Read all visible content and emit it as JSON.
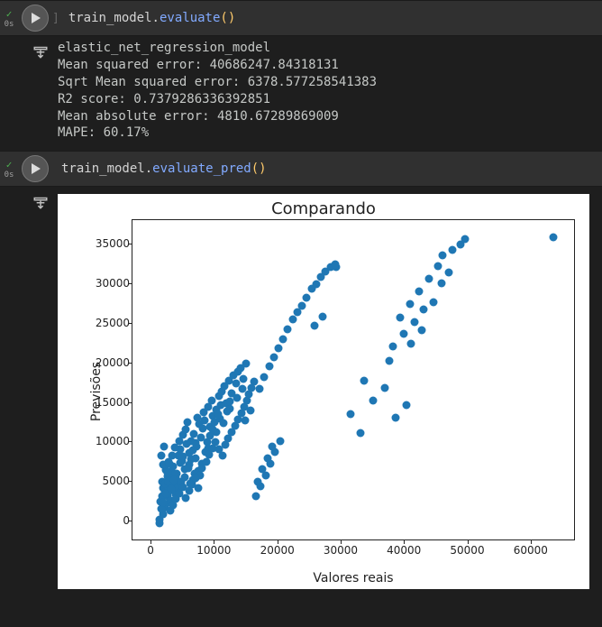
{
  "cell1": {
    "status_time": "0s",
    "code_obj": "train_model",
    "code_dot": ".",
    "code_func": "evaluate",
    "code_open": "(",
    "code_close": ")",
    "output_lines": [
      "elastic_net_regression_model",
      "Mean squared error: 40686247.84318131",
      "Sqrt Mean squared error: 6378.577258541383",
      "R2 score: 0.7379286336392851",
      "Mean absolute error: 4810.67289869009",
      "MAPE: 60.17%"
    ]
  },
  "cell2": {
    "status_time": "0s",
    "code_obj": "train_model",
    "code_dot": ".",
    "code_func": "evaluate_pred",
    "code_open": "(",
    "code_close": ")"
  },
  "chart_data": {
    "type": "scatter",
    "title": "Comparando",
    "xlabel": "Valores reais",
    "ylabel": "Previsões",
    "xlim": [
      -3000,
      67000
    ],
    "ylim": [
      -2500,
      38000
    ],
    "xticks": [
      0,
      10000,
      20000,
      30000,
      40000,
      50000,
      60000
    ],
    "yticks": [
      0,
      5000,
      10000,
      15000,
      20000,
      25000,
      30000,
      35000
    ],
    "series": [
      {
        "name": "pred_vs_real",
        "points": [
          [
            1200,
            -200
          ],
          [
            1300,
            250
          ],
          [
            1800,
            900
          ],
          [
            2000,
            1800
          ],
          [
            1400,
            2600
          ],
          [
            2200,
            2200
          ],
          [
            2500,
            3200
          ],
          [
            1900,
            4200
          ],
          [
            2800,
            3900
          ],
          [
            1700,
            5100
          ],
          [
            3200,
            4800
          ],
          [
            3000,
            2700
          ],
          [
            2600,
            5700
          ],
          [
            3600,
            5200
          ],
          [
            3100,
            6300
          ],
          [
            4000,
            6100
          ],
          [
            3400,
            7000
          ],
          [
            4500,
            7400
          ],
          [
            3800,
            5600
          ],
          [
            4200,
            8300
          ],
          [
            4800,
            7700
          ],
          [
            5200,
            6600
          ],
          [
            4600,
            9100
          ],
          [
            5000,
            8200
          ],
          [
            5500,
            9800
          ],
          [
            5900,
            8700
          ],
          [
            6300,
            10200
          ],
          [
            6000,
            7200
          ],
          [
            6700,
            11100
          ],
          [
            7100,
            9500
          ],
          [
            7500,
            12300
          ],
          [
            7800,
            10600
          ],
          [
            6900,
            8000
          ],
          [
            7300,
            13100
          ],
          [
            8100,
            11800
          ],
          [
            8400,
            12800
          ],
          [
            8800,
            10000
          ],
          [
            8200,
            13800
          ],
          [
            9000,
            14500
          ],
          [
            9300,
            12000
          ],
          [
            9700,
            13300
          ],
          [
            9500,
            15300
          ],
          [
            10200,
            14100
          ],
          [
            10600,
            15800
          ],
          [
            10300,
            11300
          ],
          [
            11100,
            16400
          ],
          [
            10800,
            13000
          ],
          [
            11500,
            17100
          ],
          [
            11800,
            15000
          ],
          [
            12200,
            17800
          ],
          [
            12600,
            16200
          ],
          [
            12900,
            18500
          ],
          [
            12400,
            14300
          ],
          [
            13300,
            17400
          ],
          [
            13700,
            18900
          ],
          [
            13500,
            15600
          ],
          [
            14100,
            19400
          ],
          [
            14500,
            18000
          ],
          [
            14300,
            16800
          ],
          [
            14900,
            19900
          ],
          [
            3900,
            3400
          ],
          [
            4300,
            4500
          ],
          [
            4700,
            5000
          ],
          [
            5300,
            5600
          ],
          [
            5800,
            6800
          ],
          [
            6200,
            7900
          ],
          [
            6600,
            9000
          ],
          [
            7000,
            9900
          ],
          [
            7400,
            6400
          ],
          [
            7900,
            7300
          ],
          [
            8500,
            8800
          ],
          [
            8900,
            9300
          ],
          [
            9200,
            10800
          ],
          [
            9600,
            11600
          ],
          [
            10000,
            12500
          ],
          [
            10500,
            13600
          ],
          [
            11000,
            14700
          ],
          [
            11400,
            12400
          ],
          [
            11900,
            13900
          ],
          [
            12300,
            15200
          ],
          [
            2300,
            6500
          ],
          [
            2700,
            7600
          ],
          [
            3300,
            8400
          ],
          [
            3700,
            9400
          ],
          [
            4100,
            4200
          ],
          [
            4400,
            10200
          ],
          [
            4900,
            11000
          ],
          [
            5400,
            11700
          ],
          [
            5700,
            12600
          ],
          [
            6100,
            4800
          ],
          [
            2100,
            3800
          ],
          [
            2400,
            4600
          ],
          [
            2900,
            5400
          ],
          [
            3500,
            6000
          ],
          [
            1800,
            7200
          ],
          [
            1600,
            8300
          ],
          [
            2000,
            9500
          ],
          [
            6500,
            5300
          ],
          [
            6800,
            6100
          ],
          [
            7600,
            5800
          ],
          [
            16500,
            3200
          ],
          [
            17200,
            4500
          ],
          [
            18000,
            5900
          ],
          [
            18800,
            7300
          ],
          [
            19500,
            8800
          ],
          [
            20300,
            10200
          ],
          [
            16800,
            5100
          ],
          [
            17500,
            6600
          ],
          [
            18300,
            8000
          ],
          [
            19000,
            9500
          ],
          [
            17000,
            16800
          ],
          [
            17800,
            18200
          ],
          [
            18600,
            19600
          ],
          [
            19300,
            20800
          ],
          [
            20000,
            21900
          ],
          [
            20800,
            23000
          ],
          [
            21500,
            24300
          ],
          [
            22300,
            25500
          ],
          [
            23100,
            26400
          ],
          [
            23800,
            27200
          ],
          [
            24500,
            28300
          ],
          [
            25300,
            29400
          ],
          [
            26000,
            30000
          ],
          [
            26800,
            30900
          ],
          [
            27500,
            31500
          ],
          [
            28300,
            32100
          ],
          [
            29100,
            32100
          ],
          [
            29000,
            32500
          ],
          [
            27000,
            25900
          ],
          [
            25800,
            24700
          ],
          [
            33500,
            17800
          ],
          [
            31500,
            13600
          ],
          [
            35000,
            15300
          ],
          [
            36800,
            16900
          ],
          [
            38500,
            13100
          ],
          [
            40200,
            14700
          ],
          [
            33000,
            11200
          ],
          [
            37500,
            20300
          ],
          [
            41000,
            22500
          ],
          [
            42700,
            24200
          ],
          [
            39300,
            25800
          ],
          [
            40800,
            27500
          ],
          [
            42300,
            29100
          ],
          [
            43800,
            30700
          ],
          [
            45200,
            32200
          ],
          [
            46000,
            33600
          ],
          [
            47500,
            34300
          ],
          [
            48800,
            35000
          ],
          [
            49500,
            35600
          ],
          [
            44500,
            27700
          ],
          [
            63500,
            35900
          ],
          [
            45800,
            30100
          ],
          [
            47000,
            31400
          ],
          [
            43000,
            26800
          ],
          [
            41500,
            25200
          ],
          [
            39800,
            23700
          ],
          [
            38100,
            22100
          ],
          [
            3000,
            1400
          ],
          [
            3400,
            2100
          ],
          [
            3900,
            2900
          ],
          [
            4400,
            3600
          ],
          [
            4900,
            4400
          ],
          [
            5400,
            3000
          ],
          [
            5900,
            3900
          ],
          [
            6400,
            4700
          ],
          [
            6900,
            5500
          ],
          [
            7400,
            4300
          ],
          [
            1500,
            1600
          ],
          [
            1700,
            3200
          ],
          [
            2100,
            4800
          ],
          [
            2500,
            6200
          ],
          [
            2900,
            7300
          ],
          [
            1900,
            2400
          ],
          [
            2300,
            3600
          ],
          [
            2700,
            5000
          ],
          [
            3100,
            4100
          ],
          [
            3500,
            5300
          ],
          [
            8000,
            6700
          ],
          [
            8600,
            7600
          ],
          [
            9100,
            8500
          ],
          [
            9600,
            9300
          ],
          [
            10100,
            10100
          ],
          [
            10700,
            9100
          ],
          [
            11200,
            8300
          ],
          [
            11700,
            9700
          ],
          [
            12100,
            10500
          ],
          [
            12700,
            11300
          ],
          [
            13200,
            12100
          ],
          [
            13700,
            12900
          ],
          [
            14200,
            13700
          ],
          [
            14600,
            14500
          ],
          [
            15000,
            15300
          ],
          [
            15400,
            16100
          ],
          [
            15800,
            16900
          ],
          [
            16200,
            17700
          ],
          [
            15600,
            14000
          ],
          [
            14800,
            12800
          ]
        ]
      }
    ]
  }
}
